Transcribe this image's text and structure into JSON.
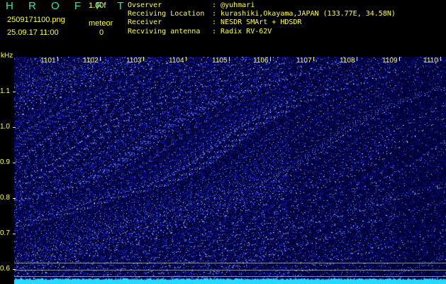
{
  "header": {
    "app_title": "H R O F F T",
    "version": "1.00f",
    "filename": "2509171100.png",
    "datetime": "25.09.17 11:00",
    "meteor_label": "meteor",
    "meteor_count": "0"
  },
  "info": {
    "observer_label": "Ovserver",
    "observer_value": "@yuhmari",
    "location_label": "Receiving Location",
    "location_value": "kurashiki,Okayama,JAPAN (133.77E, 34.58N)",
    "receiver_label": "Receiver",
    "receiver_value": "NESDR SMArt + HDSDR",
    "antenna_label": "Recviving antenna",
    "antenna_value": "Radix RV-62V"
  },
  "y_axis": {
    "unit_label": "kHz",
    "ticks": [
      "1.1",
      "1.0",
      "0.9",
      "0.8",
      "0.7",
      "0.6"
    ]
  },
  "x_axis": {
    "ticks": [
      "1101",
      "1102",
      "1103",
      "1104",
      "1105",
      "1106",
      "1107",
      "1108",
      "1109",
      "1110"
    ]
  },
  "colors": {
    "background": "#000000",
    "label": "#ffff40",
    "title": "#2ee8b0",
    "spectrum_base": "#00004a",
    "bottom_band": "#28d8ff"
  }
}
